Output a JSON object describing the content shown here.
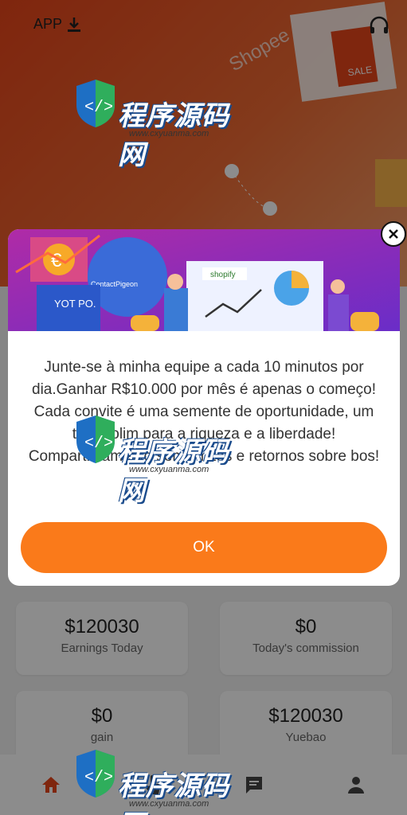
{
  "header": {
    "app_label": "APP"
  },
  "stats": [
    {
      "value": "$120030",
      "label": "Earnings Today"
    },
    {
      "value": "$0",
      "label": "Today's commission"
    },
    {
      "value": "$0",
      "label": "gain"
    },
    {
      "value": "$120030",
      "label": "Yuebao"
    }
  ],
  "hero": {
    "brand_text": "Shopee",
    "sale_text": "SALE"
  },
  "modal": {
    "banner": {
      "shopify_label": "shopify",
      "contact_label": "ContactPigeon",
      "yotpo_label": "YOT PO.",
      "euro_symbol": "€"
    },
    "message": "Junte-se à minha equipe a cada 10 minutos por dia.Ganhar R$10.000 por mês é apenas o começo!  Cada convite é uma semente de oportunidade, um trampolim para a riqueza e a liberdade! Compartilhamento sem limites e retornos sobre bos!",
    "ok_label": "OK"
  },
  "watermark": {
    "cn": "程序源码网",
    "url": "www.cxyuanma.com"
  },
  "colors": {
    "accent": "#fa7a1a",
    "hero": "#e8451a"
  },
  "icons": {
    "download": "download-icon",
    "support": "headset-icon",
    "close": "close-icon",
    "home": "home-icon",
    "task": "hand-icon",
    "message": "message-icon",
    "user": "user-icon"
  }
}
